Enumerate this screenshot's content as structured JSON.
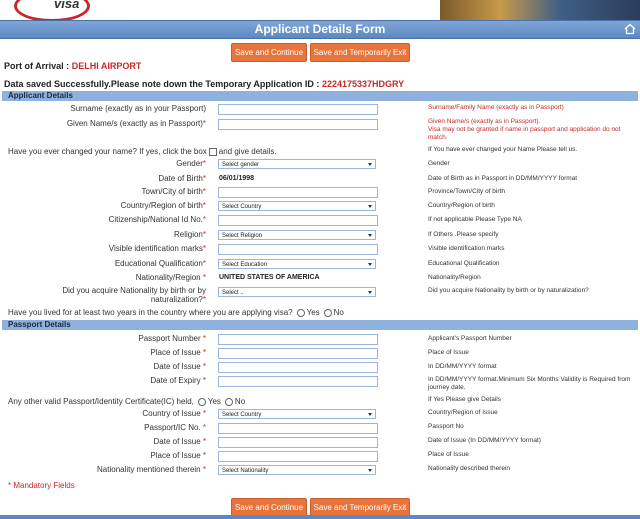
{
  "header": {
    "logo_text": "visa",
    "title": "Applicant Details Form"
  },
  "buttons": {
    "save_continue": "Save and Continue",
    "save_exit": "Save and Temporarily Exit"
  },
  "port": {
    "label": "Port of Arrival :",
    "value": "DELHI AIRPORT"
  },
  "saved": {
    "message": "Data saved Successfully.Please note down the Temporary Application ID :",
    "id": "2224175337HDGRY"
  },
  "sections": {
    "applicant": "Applicant Details",
    "passport": "Passport Details"
  },
  "applicant": {
    "surname_label": "Surname (exactly as in your Passport)",
    "surname_hint": "Surname/Family Name (exactly as in Passport)",
    "given_label": "Given Name/s (exactly as in Passport)",
    "given_hint": "Given Name/s (exactly as in Passport).",
    "given_hint2": "Visa may not be granted if name in passport and application do not match.",
    "changed_name_q": "Have you ever changed your name? If yes, click the box",
    "changed_name_q2": "and give details.",
    "changed_name_hint": "If You have ever changed your Name Please tell us.",
    "gender_label": "Gender",
    "gender_value": "Select gender",
    "gender_hint": "Gender",
    "dob_label": "Date of Birth",
    "dob_value": "06/01/1998",
    "dob_hint": "Date of Birth as in Passport in DD/MM/YYYY format",
    "town_label": "Town/City of birth",
    "town_hint": "Province/Town/City of birth",
    "country_label": "Country/Region of birth",
    "country_value": "Select Country",
    "country_hint": "Country/Region of birth",
    "citizen_label": "Citizenship/National Id No.",
    "citizen_hint": "If not applicable Please Type NA",
    "religion_label": "Religion",
    "religion_value": "Select Religion",
    "religion_hint": "If Others .Please specify",
    "marks_label": "Visible identification marks",
    "marks_hint": "Visible identification marks",
    "edu_label": "Educational Qualification",
    "edu_value": "Select Education",
    "edu_hint": "Educational Qualification",
    "nat_label": "Nationality/Region",
    "nat_value": "UNITED STATES OF AMERICA",
    "nat_hint": "Nationality/Region",
    "acquire_label": "Did you acquire Nationality by birth or by",
    "acquire_label2": "naturalization?",
    "acquire_value": "Select ..",
    "acquire_hint": "Did you acquire Nationality by birth or by naturalization?",
    "lived_q": "Have you lived for at least two years in the country where you are applying visa?",
    "yes": "Yes",
    "no": "No"
  },
  "passport": {
    "number_label": "Passport Number",
    "number_hint": "Applicant's Passport Number",
    "place_label": "Place of Issue",
    "place_hint": "Place of Issue",
    "date_label": "Date of Issue",
    "date_hint": "In DD/MM/YYYY format",
    "expiry_label": "Date of Expiry",
    "expiry_hint": "In DD/MM/YYYY format.Minimum Six Months Validity is Required from journey date.",
    "other_q": "Any other valid Passport/Identity Certificate(IC) held,",
    "other_hint": "If Yes Please give Details",
    "ic_country_label": "Country of Issue",
    "ic_country_value": "Select Country",
    "ic_country_hint": "Country/Region of Issue",
    "ic_no_label": "Passport/IC No.",
    "ic_no_hint": "Passport No",
    "ic_date_label": "Date of Issue",
    "ic_date_hint": "Date of Issue (In DD/MM/YYYY format)",
    "ic_place_label": "Place of Issue",
    "ic_place_hint": "Place of Issue",
    "ic_nat_label": "Nationality mentioned therein",
    "ic_nat_value": "Select Nationality",
    "ic_nat_hint": "Nationality described therein",
    "yes": "Yes",
    "no": "No"
  },
  "mandatory": "* Mandatory Fields",
  "asterisk": "*"
}
